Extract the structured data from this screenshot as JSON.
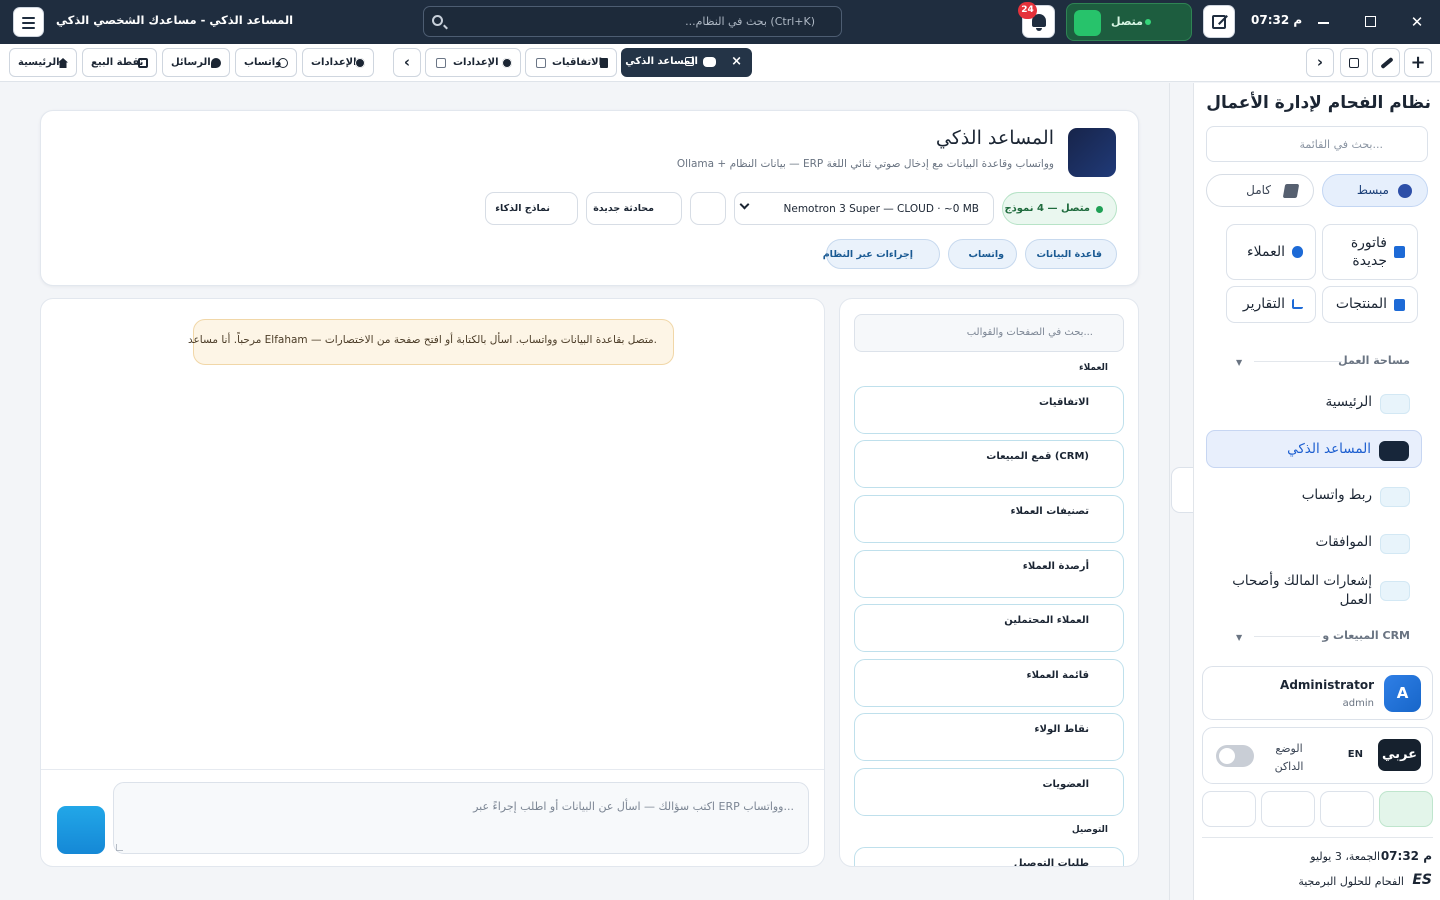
{
  "titlebar": {
    "title": "المساعد الذكي - مساعدك الشخصي الذكي",
    "search_placeholder": "...بحث في النظام (Ctrl+K)",
    "notifications_count": "24",
    "connection_label": "متصل",
    "clock": "07:32 م",
    "close_glyph": "✕"
  },
  "tabbar": {
    "home": "الرئيسية",
    "pos": "نقطة البيع",
    "messages": "الرسائل",
    "whatsapp": "واتساب",
    "settings": "الإعدادات",
    "prev_glyph": "‹",
    "tab_settings": "الإعدادات",
    "tab_agreements": "الاتفاقيات",
    "tab_assistant": "المساعد الذكي",
    "tab_close": "×",
    "next_glyph": "›",
    "add_glyph": "+"
  },
  "header": {
    "title": "المساعد الذكي",
    "subtitle": "Ollama + بيانات النظام — ERP وواتساب وقاعدة البيانات مع إدخال صوتي ثنائي اللغة",
    "status": "متصل — 4 نموذج",
    "model": "Nemotron 3 Super — CLOUD · ~0 MB",
    "new_chat": "محادثة جديدة",
    "ai_models": "نماذج الذكاء",
    "chips": [
      "قاعدة البيانات",
      "واتساب",
      "إجراءات عبر النظام"
    ]
  },
  "chat": {
    "welcome": "مرحباً. أنا مساعد Elfaham — متصل بقاعدة البيانات وواتساب. اسأل بالكتابة أو افتح صفحة من الاختصارات.",
    "input_placeholder": "اكتب سؤالك — اسأل عن البيانات أو اطلب إجراءً عبر ERP وواتساب..."
  },
  "shortcuts": {
    "search_placeholder": "بحث في الصفحات والقوالب...",
    "group_customers": "العملاء",
    "items": [
      "الاتفاقيات",
      "قمع المبيعات (CRM)",
      "تصنيفات العملاء",
      "أرصدة العملاء",
      "العملاء المحتملين",
      "قائمة العملاء",
      "نقاط الولاء",
      "العضويات"
    ],
    "group_delivery": "التوصيل",
    "delivery_first": "طلبات التوصيل"
  },
  "sidebar": {
    "brand": "نظام الفحام لإدارة الأعمال",
    "search_placeholder": "بحث في القائمة...",
    "mode_simple": "مبسط",
    "mode_full": "كامل",
    "quick": {
      "new_invoice": "فاتورة جديدة",
      "customers": "العملاء",
      "products": "المنتجات",
      "reports": "التقارير"
    },
    "section_workspace": "مساحة العمل",
    "nav": {
      "home": "الرئيسية",
      "assistant": "المساعد الذكي",
      "whatsapp_link": "ربط واتساب",
      "approvals": "الموافقات",
      "owner_notifications": "إشعارات المالك وأصحاب العمل"
    },
    "section_sales": "المبيعات و CRM",
    "user": {
      "name": "Administrator",
      "role": "admin",
      "initial": "A"
    },
    "prefs": {
      "lang_ar": "عربي",
      "lang_en": "EN",
      "dark_mode": "الوضع الداكن"
    },
    "footer": {
      "time": "07:32 م",
      "date": "الجمعة، 3 يوليو",
      "company": "الفحام للحلول البرمجية",
      "logo": "ES"
    }
  },
  "colors": {
    "titlebar": "#1f2d3f",
    "accent": "#1d6ad6",
    "online": "#27c36b",
    "badge": "#e5323b"
  }
}
